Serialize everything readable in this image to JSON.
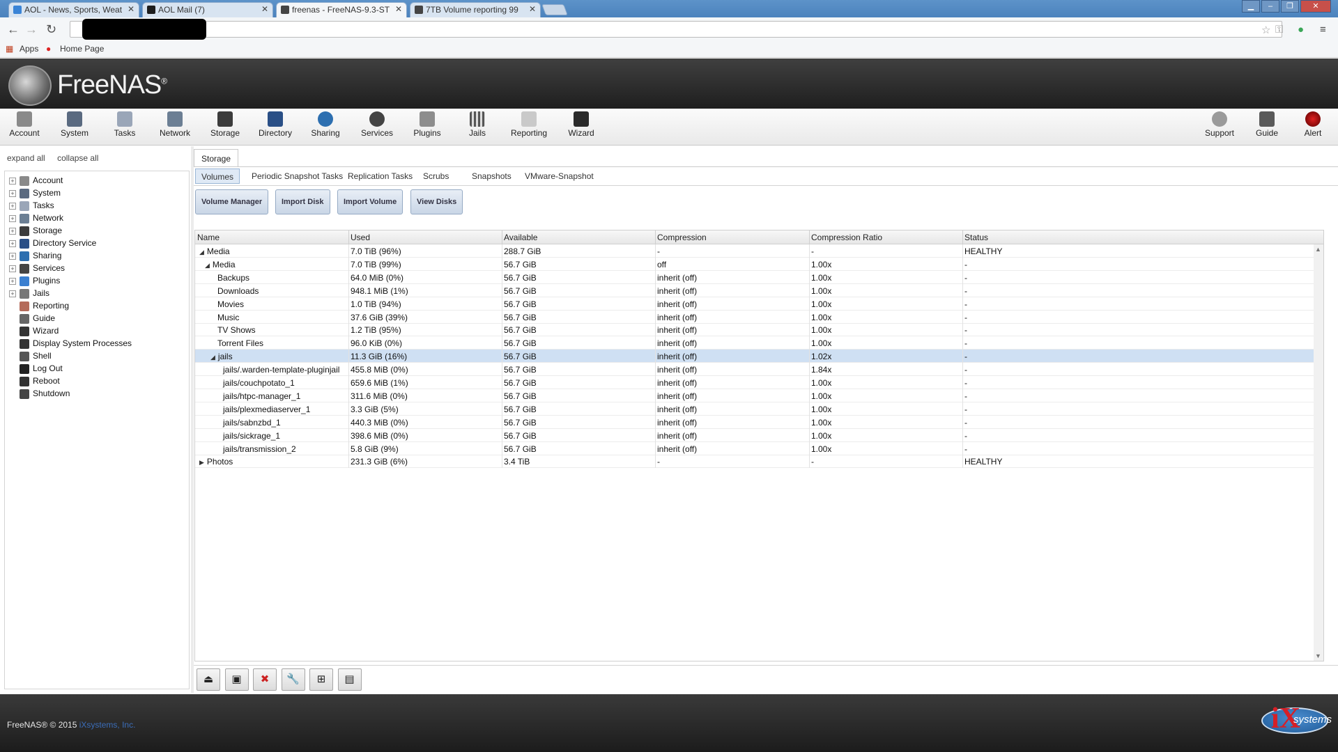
{
  "browser": {
    "tabs": [
      {
        "title": "AOL - News, Sports, Weat",
        "active": false
      },
      {
        "title": "AOL Mail (7)",
        "active": false
      },
      {
        "title": "freenas - FreeNAS-9.3-ST",
        "active": true
      },
      {
        "title": "7TB Volume reporting 99",
        "active": false
      }
    ],
    "bookmarks": {
      "apps": "Apps",
      "home": "Home Page"
    }
  },
  "header": {
    "brand": "FreeNAS",
    "registered": "®"
  },
  "topnav": {
    "items": [
      {
        "label": "Account"
      },
      {
        "label": "System"
      },
      {
        "label": "Tasks"
      },
      {
        "label": "Network"
      },
      {
        "label": "Storage"
      },
      {
        "label": "Directory"
      },
      {
        "label": "Sharing"
      },
      {
        "label": "Services"
      },
      {
        "label": "Plugins"
      },
      {
        "label": "Jails"
      },
      {
        "label": "Reporting"
      },
      {
        "label": "Wizard"
      }
    ],
    "right_items": [
      {
        "label": "Support"
      },
      {
        "label": "Guide"
      },
      {
        "label": "Alert"
      }
    ]
  },
  "sidebar": {
    "expand_all": "expand all",
    "collapse_all": "collapse all",
    "items": [
      {
        "label": "Account",
        "expandable": true,
        "icon": "account-icon"
      },
      {
        "label": "System",
        "expandable": true,
        "icon": "system-icon"
      },
      {
        "label": "Tasks",
        "expandable": true,
        "icon": "tasks-icon"
      },
      {
        "label": "Network",
        "expandable": true,
        "icon": "network-icon"
      },
      {
        "label": "Storage",
        "expandable": true,
        "icon": "storage-icon"
      },
      {
        "label": "Directory Service",
        "expandable": true,
        "icon": "directory-icon"
      },
      {
        "label": "Sharing",
        "expandable": true,
        "icon": "sharing-icon"
      },
      {
        "label": "Services",
        "expandable": true,
        "icon": "services-icon"
      },
      {
        "label": "Plugins",
        "expandable": true,
        "icon": "plugins-icon"
      },
      {
        "label": "Jails",
        "expandable": true,
        "icon": "jails-icon"
      },
      {
        "label": "Reporting",
        "expandable": false,
        "icon": "reporting-icon"
      },
      {
        "label": "Guide",
        "expandable": false,
        "icon": "guide-icon"
      },
      {
        "label": "Wizard",
        "expandable": false,
        "icon": "wizard-icon"
      },
      {
        "label": "Display System Processes",
        "expandable": false,
        "icon": "processes-icon"
      },
      {
        "label": "Shell",
        "expandable": false,
        "icon": "shell-icon"
      },
      {
        "label": "Log Out",
        "expandable": false,
        "icon": "logout-icon"
      },
      {
        "label": "Reboot",
        "expandable": false,
        "icon": "reboot-icon"
      },
      {
        "label": "Shutdown",
        "expandable": false,
        "icon": "shutdown-icon"
      }
    ]
  },
  "main": {
    "outer_tab": "Storage",
    "subtabs": [
      "Volumes",
      "Periodic Snapshot Tasks",
      "Replication Tasks",
      "Scrubs",
      "Snapshots",
      "VMware-Snapshot"
    ],
    "buttons": [
      "Volume Manager",
      "Import Disk",
      "Import Volume",
      "View Disks"
    ],
    "columns": [
      "Name",
      "Used",
      "Available",
      "Compression",
      "Compression Ratio",
      "Status"
    ],
    "rows": [
      {
        "name": "Media",
        "indent": 0,
        "toggle": "open",
        "used": "7.0 TiB (96%)",
        "available": "288.7 GiB",
        "compression": "-",
        "ratio": "-",
        "status": "HEALTHY"
      },
      {
        "name": "Media",
        "indent": 1,
        "toggle": "open",
        "used": "7.0 TiB (99%)",
        "available": "56.7 GiB",
        "compression": "off",
        "ratio": "1.00x",
        "status": "-"
      },
      {
        "name": "Backups",
        "indent": 2,
        "toggle": "",
        "used": "64.0 MiB (0%)",
        "available": "56.7 GiB",
        "compression": "inherit (off)",
        "ratio": "1.00x",
        "status": "-"
      },
      {
        "name": "Downloads",
        "indent": 2,
        "toggle": "",
        "used": "948.1 MiB (1%)",
        "available": "56.7 GiB",
        "compression": "inherit (off)",
        "ratio": "1.00x",
        "status": "-"
      },
      {
        "name": "Movies",
        "indent": 2,
        "toggle": "",
        "used": "1.0 TiB (94%)",
        "available": "56.7 GiB",
        "compression": "inherit (off)",
        "ratio": "1.00x",
        "status": "-"
      },
      {
        "name": "Music",
        "indent": 2,
        "toggle": "",
        "used": "37.6 GiB (39%)",
        "available": "56.7 GiB",
        "compression": "inherit (off)",
        "ratio": "1.00x",
        "status": "-"
      },
      {
        "name": "TV Shows",
        "indent": 2,
        "toggle": "",
        "used": "1.2 TiB (95%)",
        "available": "56.7 GiB",
        "compression": "inherit (off)",
        "ratio": "1.00x",
        "status": "-"
      },
      {
        "name": "Torrent Files",
        "indent": 2,
        "toggle": "",
        "used": "96.0 KiB (0%)",
        "available": "56.7 GiB",
        "compression": "inherit (off)",
        "ratio": "1.00x",
        "status": "-"
      },
      {
        "name": "jails",
        "indent": 2,
        "toggle": "open",
        "used": "11.3 GiB (16%)",
        "available": "56.7 GiB",
        "compression": "inherit (off)",
        "ratio": "1.02x",
        "status": "-",
        "selected": true
      },
      {
        "name": "jails/.warden-template-pluginjail",
        "indent": 3,
        "toggle": "",
        "used": "455.8 MiB (0%)",
        "available": "56.7 GiB",
        "compression": "inherit (off)",
        "ratio": "1.84x",
        "status": "-"
      },
      {
        "name": "jails/couchpotato_1",
        "indent": 3,
        "toggle": "",
        "used": "659.6 MiB (1%)",
        "available": "56.7 GiB",
        "compression": "inherit (off)",
        "ratio": "1.00x",
        "status": "-"
      },
      {
        "name": "jails/htpc-manager_1",
        "indent": 3,
        "toggle": "",
        "used": "311.6 MiB (0%)",
        "available": "56.7 GiB",
        "compression": "inherit (off)",
        "ratio": "1.00x",
        "status": "-"
      },
      {
        "name": "jails/plexmediaserver_1",
        "indent": 3,
        "toggle": "",
        "used": "3.3 GiB (5%)",
        "available": "56.7 GiB",
        "compression": "inherit (off)",
        "ratio": "1.00x",
        "status": "-"
      },
      {
        "name": "jails/sabnzbd_1",
        "indent": 3,
        "toggle": "",
        "used": "440.3 MiB (0%)",
        "available": "56.7 GiB",
        "compression": "inherit (off)",
        "ratio": "1.00x",
        "status": "-"
      },
      {
        "name": "jails/sickrage_1",
        "indent": 3,
        "toggle": "",
        "used": "398.6 MiB (0%)",
        "available": "56.7 GiB",
        "compression": "inherit (off)",
        "ratio": "1.00x",
        "status": "-"
      },
      {
        "name": "jails/transmission_2",
        "indent": 3,
        "toggle": "",
        "used": "5.8 GiB (9%)",
        "available": "56.7 GiB",
        "compression": "inherit (off)",
        "ratio": "1.00x",
        "status": "-"
      },
      {
        "name": "Photos",
        "indent": 0,
        "toggle": "closed",
        "used": "231.3 GiB (6%)",
        "available": "3.4 TiB",
        "compression": "-",
        "ratio": "-",
        "status": "HEALTHY"
      }
    ],
    "bottom_buttons": [
      "detach-volume-icon",
      "extend-volume-icon",
      "delete-dataset-icon",
      "edit-options-icon",
      "create-zvol-icon",
      "volume-status-icon"
    ]
  },
  "footer": {
    "copyright": "FreeNAS® © 2015",
    "company": "iXsystems, Inc."
  },
  "colors": {
    "selected_row": "#cfe0f3",
    "header_dark": "#2a2a2a",
    "accent_blue": "#3b6db8"
  }
}
